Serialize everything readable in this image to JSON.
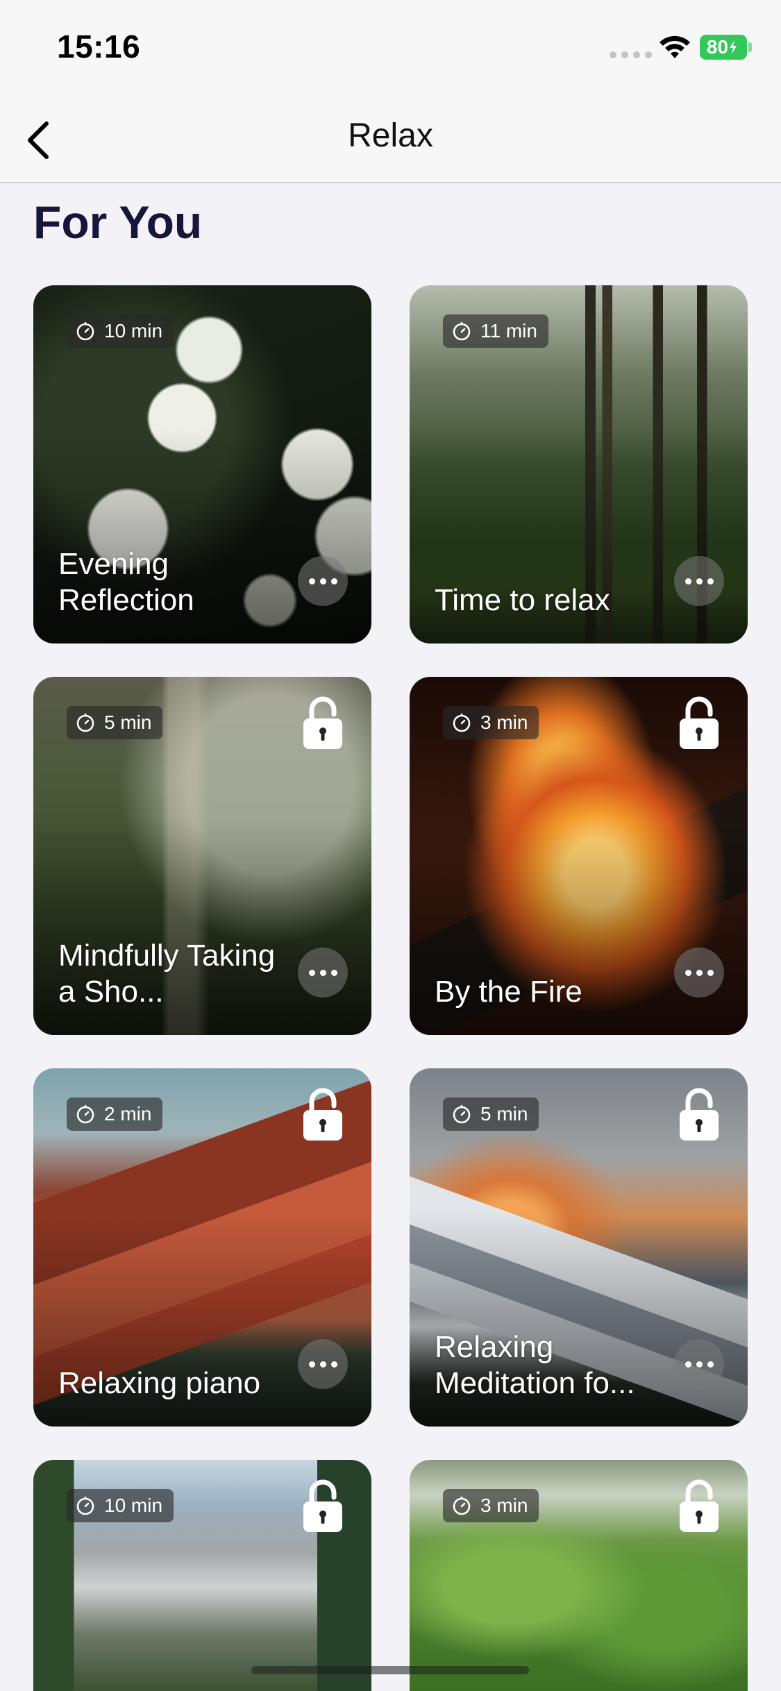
{
  "status_bar": {
    "time": "15:16",
    "battery": "80",
    "icons": [
      "signal-dots-icon",
      "wifi-icon",
      "battery-icon"
    ]
  },
  "nav": {
    "title": "Relax",
    "back_icon": "chevron-left-icon"
  },
  "section": {
    "title": "For You"
  },
  "cards": [
    {
      "title": "Evening Reflection",
      "duration": "10 min",
      "locked": false,
      "image": "white-flowers"
    },
    {
      "title": "Time to relax",
      "duration": "11 min",
      "locked": false,
      "image": "forest"
    },
    {
      "title": "Mindfully Taking a Sho...",
      "duration": "5 min",
      "locked": true,
      "image": "misty-shower"
    },
    {
      "title": "By the Fire",
      "duration": "3 min",
      "locked": true,
      "image": "campfire"
    },
    {
      "title": "Relaxing piano",
      "duration": "2 min",
      "locked": true,
      "image": "red-mountain"
    },
    {
      "title": "Relaxing Meditation fo...",
      "duration": "5 min",
      "locked": true,
      "image": "snowy-peak-sunset"
    },
    {
      "title": "",
      "duration": "10 min",
      "locked": true,
      "image": "alpine-mountains"
    },
    {
      "title": "",
      "duration": "3 min",
      "locked": true,
      "image": "ferns"
    }
  ]
}
